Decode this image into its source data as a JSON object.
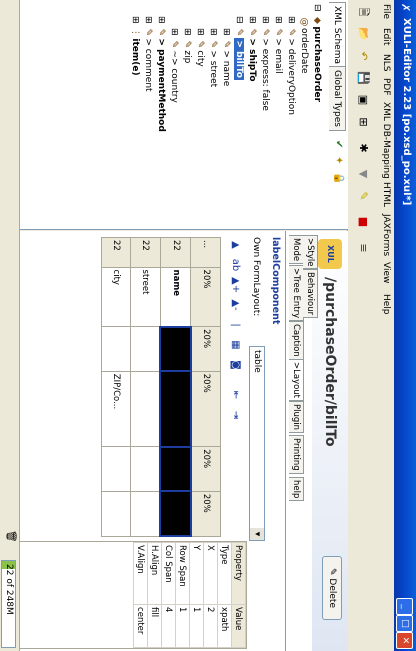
{
  "window": {
    "title": "XULI-Editor 2.23 [po.xsd_po.xul*]"
  },
  "menu": [
    "File",
    "Edit",
    "NLS",
    "PDF",
    "XML DB-Mapping",
    "HTML",
    "JAXForms",
    "View",
    "Help"
  ],
  "left_tabs": [
    "XML Schema",
    "Global Types"
  ],
  "tree": [
    {
      "label": "purchaseOrder",
      "bold": true
    },
    {
      "label": "orderDate",
      "prefix": "@"
    },
    {
      "label": "> deliveryOption"
    },
    {
      "label": "> email"
    },
    {
      "label": "> express: false"
    },
    {
      "label": "> shipTo",
      "bold": true
    },
    {
      "label": "> billTo",
      "bold": true,
      "selected": true
    },
    {
      "label": "> name"
    },
    {
      "label": "> street"
    },
    {
      "label": "city"
    },
    {
      "label": "zip"
    },
    {
      "label": "~> country"
    },
    {
      "label": "> paymentMethod",
      "bold": true
    },
    {
      "label": "> comment"
    },
    {
      "label": "item(e)",
      "bold": true
    }
  ],
  "editor": {
    "path": "/purchaseOrder/billTo",
    "delete_label": "Delete",
    "tabs": [
      "Mode",
      ">Tree Entry",
      "Caption",
      ">Layout",
      "Plugin",
      "Printing",
      "help"
    ],
    "style_tabs": [
      ">Style",
      "Behaviour"
    ],
    "component_title": "labelComponent",
    "own_form_layout_label": "Own FormLayout:",
    "own_form_layout_value": "table"
  },
  "grid": {
    "col_pct": [
      "20%",
      "20%",
      "20%",
      "20%",
      "20%"
    ],
    "rows": [
      [
        "...",
        "20%",
        "20%",
        "20%",
        "20%",
        "20%"
      ],
      [
        "22",
        "name",
        "",
        "",
        "",
        ""
      ],
      [
        "22",
        "street",
        "",
        "",
        "",
        ""
      ],
      [
        "22",
        "city",
        "",
        "ZIP/Co...",
        "",
        ""
      ]
    ]
  },
  "properties": {
    "headers": [
      "Property",
      "Value"
    ],
    "rows": [
      [
        "Type",
        "xpath"
      ],
      [
        "X",
        "2"
      ],
      [
        "Y",
        "1"
      ],
      [
        "Row Span",
        "1"
      ],
      [
        "Col Span",
        "4"
      ],
      [
        "H.Align",
        "fill"
      ],
      [
        "V.Align",
        "center"
      ]
    ]
  },
  "status": {
    "memory": "22 of 248M",
    "memory_fraction": 0.09
  },
  "colors": {
    "titlebar": "#0543c9",
    "selection": "#316ac5",
    "accent_text": "#1c3e9e"
  }
}
